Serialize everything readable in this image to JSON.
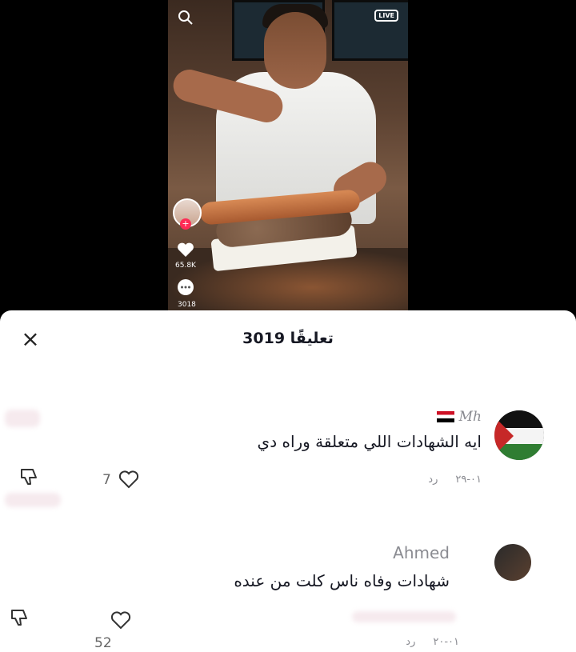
{
  "video": {
    "like_count": "65.8K",
    "comment_count": "3018",
    "live_label": "LIVE",
    "plus_symbol": "+"
  },
  "sheet": {
    "close_symbol": "×",
    "title": "3019 تعليقًا"
  },
  "comments": [
    {
      "name": "Mh",
      "text": "ايه الشهادات اللي متعلقة وراه دي",
      "date": "٠١-٢٩",
      "reply": "رد",
      "likes": "7"
    },
    {
      "name": "Ahmed",
      "text": "شهادات وفاه ناس كلت من عنده",
      "date": "٠١-٢٠",
      "reply": "رد",
      "likes": "52"
    }
  ],
  "colors": {
    "accent": "#fe2c55",
    "text": "#161823",
    "muted": "#8a8b91"
  },
  "icons": [
    "search-icon",
    "live-icon",
    "heart-icon",
    "comment-icon",
    "close-icon",
    "dislike-icon",
    "like-icon"
  ]
}
